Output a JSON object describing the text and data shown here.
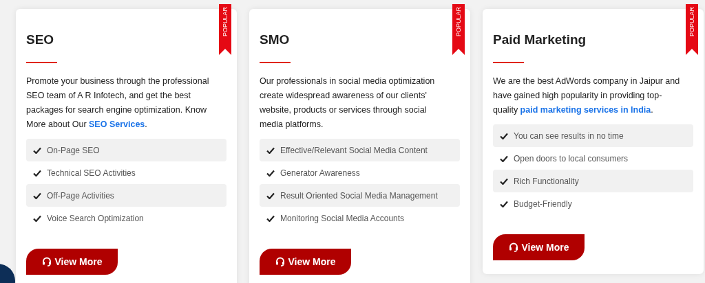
{
  "cards": [
    {
      "title": "SEO",
      "ribbon": "POPULAR",
      "description": {
        "before": "Promote your business through the professional SEO team of A R Infotech, and get the best packages for search engine optimization. Know More about Our ",
        "link": "SEO Services",
        "after": "."
      },
      "features": [
        "On-Page SEO",
        "Technical SEO Activities",
        "Off-Page Activities",
        "Voice Search Optimization"
      ],
      "button": "View More"
    },
    {
      "title": "SMO",
      "ribbon": "POPULAR",
      "description": {
        "before": "Our professionals in social media optimization create widespread awareness of our clients' website, products or services through social media platforms."
      },
      "features": [
        "Effective/Relevant Social Media Content",
        "Generator Awareness",
        "Result Oriented Social Media Management",
        "Monitoring Social Media Accounts"
      ],
      "button": "View More"
    },
    {
      "title": "Paid Marketing",
      "ribbon": "POPULAR",
      "description": {
        "before": "We are the best AdWords company in Jaipur and have gained high popularity in providing top-quality ",
        "link": "paid marketing services in India",
        "after": "."
      },
      "features": [
        "You can see results in no time",
        "Open doors to local consumers",
        "Rich Functionality",
        "Budget-Friendly"
      ],
      "button": "View More"
    }
  ]
}
